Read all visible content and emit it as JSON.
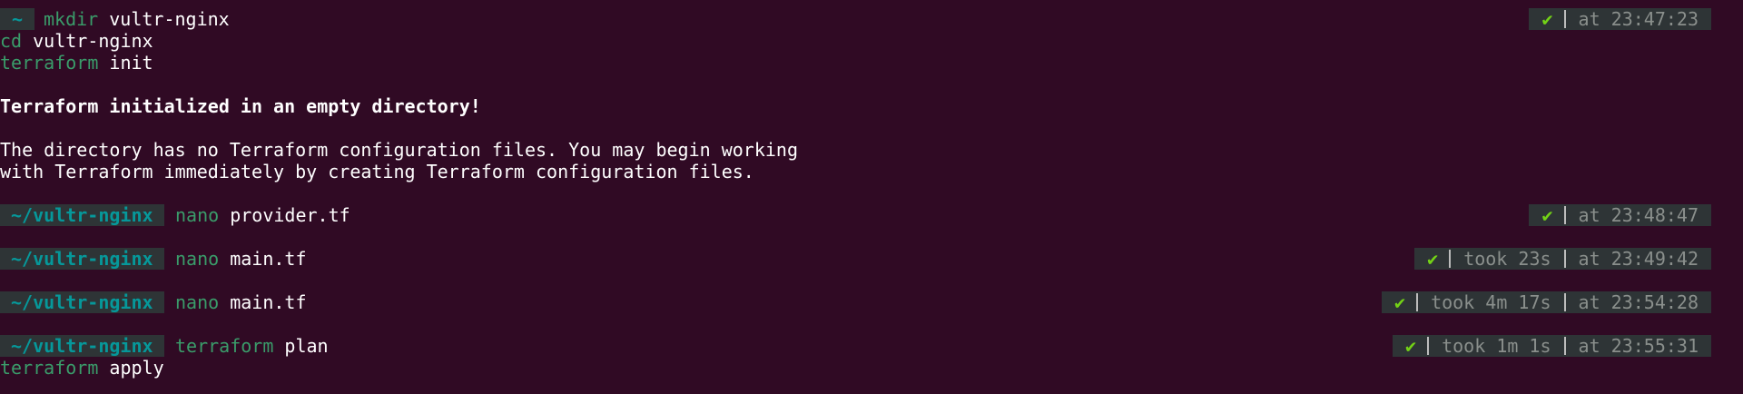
{
  "prompts": [
    {
      "dir": "~",
      "command": "mkdir",
      "args": "vultr-nginx",
      "status": "✔",
      "took": "",
      "at_label": "at",
      "time": "23:47:23"
    },
    {
      "dir": "~/vultr-nginx",
      "command": "nano",
      "args": "provider.tf",
      "status": "✔",
      "took": "",
      "at_label": "at",
      "time": "23:48:47"
    },
    {
      "dir": "~/vultr-nginx",
      "command": "nano",
      "args": "main.tf",
      "status": "✔",
      "took_label": "took",
      "took": "23s",
      "at_label": "at",
      "time": "23:49:42"
    },
    {
      "dir": "~/vultr-nginx",
      "command": "nano",
      "args": "main.tf",
      "status": "✔",
      "took_label": "took",
      "took": "4m 17s",
      "at_label": "at",
      "time": "23:54:28"
    },
    {
      "dir": "~/vultr-nginx",
      "command": "terraform",
      "args": "plan",
      "status": "✔",
      "took_label": "took",
      "took": "1m 1s",
      "at_label": "at",
      "time": "23:55:31"
    }
  ],
  "continuations": [
    {
      "command": "cd",
      "args": "vultr-nginx"
    },
    {
      "command": "terraform",
      "args": "init"
    },
    {
      "command": "terraform",
      "args": "apply"
    }
  ],
  "output": {
    "heading": "Terraform initialized in an empty directory!",
    "line1": "The directory has no Terraform configuration files. You may begin working",
    "line2": "with Terraform immediately by creating Terraform configuration files."
  },
  "colors": {
    "background": "#300a24",
    "segment_bg": "#2e3436",
    "dir": "#06989a",
    "command": "#3a9c6a",
    "check": "#73d216",
    "muted": "#8a8f8c"
  },
  "icons": {
    "status": "check-mark-icon"
  }
}
